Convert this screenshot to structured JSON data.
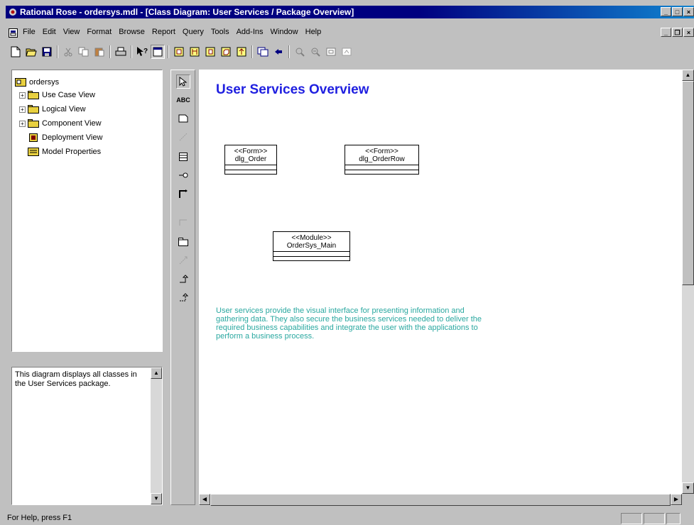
{
  "window": {
    "title": "Rational Rose - ordersys.mdl - [Class Diagram: User Services / Package Overview]",
    "app_icon": "rose-icon",
    "buttons": [
      "minimize-icon",
      "maximize-icon",
      "close-icon"
    ]
  },
  "menu": {
    "items": [
      {
        "label": "File"
      },
      {
        "label": "Edit"
      },
      {
        "label": "View"
      },
      {
        "label": "Format"
      },
      {
        "label": "Browse"
      },
      {
        "label": "Report"
      },
      {
        "label": "Query"
      },
      {
        "label": "Tools"
      },
      {
        "label": "Add-Ins"
      },
      {
        "label": "Window"
      },
      {
        "label": "Help"
      }
    ]
  },
  "toolbar": {
    "buttons": [
      "new-icon",
      "open-icon",
      "save-icon",
      "cut-icon",
      "copy-icon",
      "paste-icon",
      "print-icon",
      "context-help-icon",
      "view-documentation-icon",
      "browse-class-diagram-icon",
      "browse-interaction-diagram-icon",
      "browse-component-diagram-icon",
      "browse-deployment-diagram-icon",
      "browse-parent-icon",
      "browse-previous-diagram-icon",
      "back-icon",
      "zoom-in-icon",
      "zoom-out-icon",
      "fit-in-window-icon",
      "undo-fit-icon"
    ]
  },
  "browser": {
    "root": "ordersys",
    "items": [
      {
        "label": "Use Case View",
        "icon": "folder-icon",
        "expandable": true
      },
      {
        "label": "Logical View",
        "icon": "folder-icon",
        "expandable": true
      },
      {
        "label": "Component View",
        "icon": "folder-icon",
        "expandable": true
      },
      {
        "label": "Deployment View",
        "icon": "deployment-icon",
        "expandable": false
      },
      {
        "label": "Model Properties",
        "icon": "properties-icon",
        "expandable": false
      }
    ]
  },
  "documentation": {
    "text": "This diagram displays all classes in the User Services package."
  },
  "toolbox": {
    "tools": [
      "selection-tool-icon",
      "text-box-tool-icon",
      "note-tool-icon",
      "anchor-note-tool-icon",
      "class-tool-icon",
      "interface-tool-icon",
      "association-tool-icon",
      "unidirectional-association-tool-icon",
      "package-tool-icon",
      "dependency-tool-icon",
      "generalization-tool-icon",
      "realize-tool-icon"
    ],
    "text_tool_label": "ABC"
  },
  "diagram": {
    "title": "User Services Overview",
    "classes": [
      {
        "stereotype": "<<Form>>",
        "name": "dlg_Order"
      },
      {
        "stereotype": "<<Form>>",
        "name": "dlg_OrderRow"
      },
      {
        "stereotype": "<<Module>>",
        "name": "OrderSys_Main"
      }
    ],
    "note": "User services provide the visual interface for presenting information and gathering data. They also secure the business services needed to deliver the required business capabilities and integrate the user with the applications to perform a business process.",
    "note_color": "#2aa8a0",
    "title_color": "#1f1fe0"
  },
  "status": {
    "text": "For Help, press F1"
  }
}
